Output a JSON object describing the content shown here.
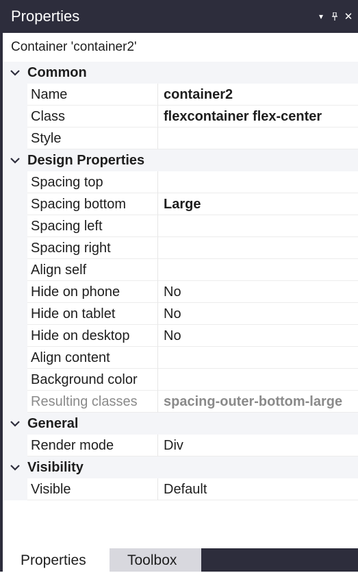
{
  "window": {
    "title": "Properties",
    "controls": {
      "dropdown_icon": "triangle-down",
      "pin_icon": "pin",
      "close_icon": "close"
    }
  },
  "selection": "Container 'container2'",
  "categories": [
    {
      "label": "Common",
      "rows": [
        {
          "name": "Name",
          "value": "container2",
          "bold": true
        },
        {
          "name": "Class",
          "value": "flexcontainer flex-center",
          "bold": true
        },
        {
          "name": "Style",
          "value": ""
        }
      ]
    },
    {
      "label": "Design Properties",
      "rows": [
        {
          "name": "Spacing top",
          "value": ""
        },
        {
          "name": "Spacing bottom",
          "value": "Large",
          "bold": true
        },
        {
          "name": "Spacing left",
          "value": ""
        },
        {
          "name": "Spacing right",
          "value": ""
        },
        {
          "name": "Align self",
          "value": ""
        },
        {
          "name": "Hide on phone",
          "value": "No"
        },
        {
          "name": "Hide on tablet",
          "value": "No"
        },
        {
          "name": "Hide on desktop",
          "value": "No"
        },
        {
          "name": "Align content",
          "value": ""
        },
        {
          "name": "Background color",
          "value": ""
        },
        {
          "name": "Resulting classes",
          "value": "spacing-outer-bottom-large",
          "bold": true,
          "readonly": true
        }
      ]
    },
    {
      "label": "General",
      "rows": [
        {
          "name": "Render mode",
          "value": "Div"
        }
      ]
    },
    {
      "label": "Visibility",
      "rows": [
        {
          "name": "Visible",
          "value": "Default"
        }
      ]
    }
  ],
  "tabs": [
    {
      "label": "Properties",
      "active": true
    },
    {
      "label": "Toolbox",
      "active": false
    }
  ],
  "colors": {
    "titlebar_bg": "#2d2d3c",
    "category_bg": "#f4f5f8",
    "readonly_text": "#8a8a8a"
  }
}
